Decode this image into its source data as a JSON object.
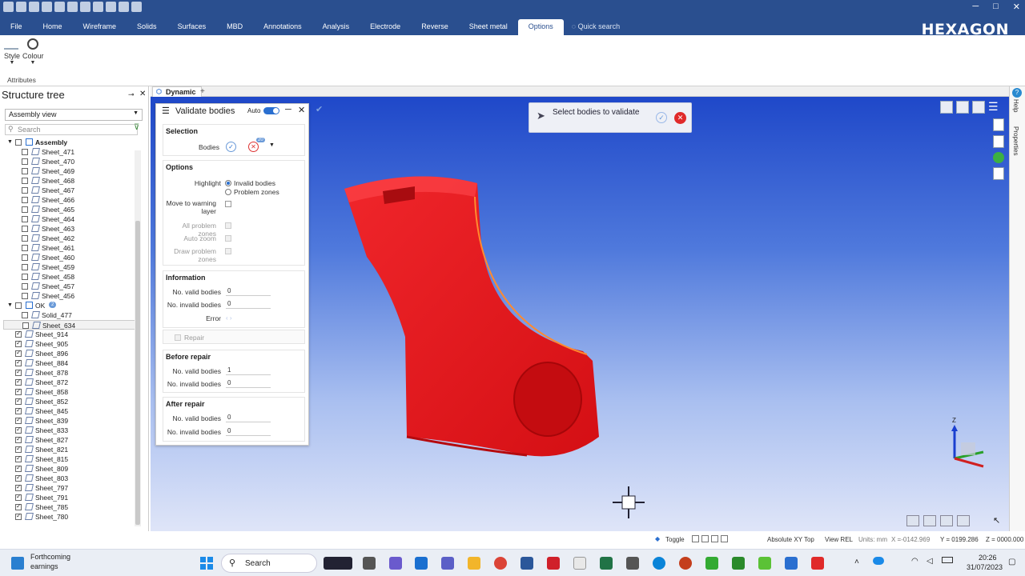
{
  "window": {
    "minimize": "─",
    "maximize": "□",
    "close": "✕"
  },
  "ribbon": {
    "tabs": [
      "File",
      "Home",
      "Wireframe",
      "Solids",
      "Surfaces",
      "MBD",
      "Annotations",
      "Analysis",
      "Electrode",
      "Reverse",
      "Sheet metal",
      "Options"
    ],
    "active_tab": "Options",
    "quick_search": "Quick search",
    "logo": "HEXAGON",
    "buttons": {
      "style": "Style",
      "colour": "Colour"
    },
    "group": "Attributes"
  },
  "tree": {
    "title": "Structure tree",
    "view": "Assembly view",
    "search_placeholder": "Search",
    "assembly": "Assembly",
    "sheets_unchecked": [
      "Sheet_471",
      "Sheet_470",
      "Sheet_469",
      "Sheet_468",
      "Sheet_467",
      "Sheet_466",
      "Sheet_465",
      "Sheet_464",
      "Sheet_463",
      "Sheet_462",
      "Sheet_461",
      "Sheet_460",
      "Sheet_459",
      "Sheet_458",
      "Sheet_457",
      "Sheet_456"
    ],
    "ok_group": "OK",
    "ok_count": "2",
    "ok_items": [
      "Solid_477",
      "Sheet_634"
    ],
    "sheets_checked": [
      "Sheet_914",
      "Sheet_905",
      "Sheet_896",
      "Sheet_884",
      "Sheet_878",
      "Sheet_872",
      "Sheet_858",
      "Sheet_852",
      "Sheet_845",
      "Sheet_839",
      "Sheet_833",
      "Sheet_827",
      "Sheet_821",
      "Sheet_815",
      "Sheet_809",
      "Sheet_803",
      "Sheet_797",
      "Sheet_791",
      "Sheet_785",
      "Sheet_780"
    ]
  },
  "doc_tab": "Dynamic",
  "panel": {
    "title": "Validate bodies",
    "auto": "Auto",
    "selection": {
      "heading": "Selection",
      "bodies": "Bodies",
      "count": "20"
    },
    "options": {
      "heading": "Options",
      "highlight": "Highlight",
      "invalid_bodies": "Invalid bodies",
      "problem_zones": "Problem zones",
      "move_warning": "Move to warning layer",
      "all_problem_zones": "All problem zones",
      "auto_zoom": "Auto zoom",
      "draw_problem_zones": "Draw problem zones"
    },
    "information": {
      "heading": "Information",
      "valid_label": "No. valid bodies",
      "valid": "0",
      "invalid_label": "No. invalid bodies",
      "invalid": "0",
      "error": "Error"
    },
    "repair": "Repair",
    "before_repair": {
      "heading": "Before repair",
      "valid_label": "No. valid bodies",
      "valid": "1",
      "invalid_label": "No. invalid bodies",
      "invalid": "0"
    },
    "after_repair": {
      "heading": "After repair",
      "valid_label": "No. valid bodies",
      "valid": "0",
      "invalid_label": "No. invalid bodies",
      "invalid": "0"
    }
  },
  "toast": {
    "text": "Select bodies to validate"
  },
  "right_tabs": [
    "Help",
    "Properties"
  ],
  "axis": {
    "z": "Z"
  },
  "status": {
    "toggle": "Toggle",
    "plane": "Absolute XY Top",
    "view": "View REL",
    "units": "Units: mm",
    "x": "X =-0142.969",
    "y": "Y = 0199.286",
    "z": "Z = 0000.000"
  },
  "taskbar": {
    "news_title": "Forthcoming",
    "news_sub": "earnings",
    "search": "Search",
    "time": "20:26",
    "date": "31/07/2023"
  },
  "colors": {
    "titlebar": "#2a4f8f",
    "model": "#e8141a",
    "accent": "#2a6fd0"
  }
}
